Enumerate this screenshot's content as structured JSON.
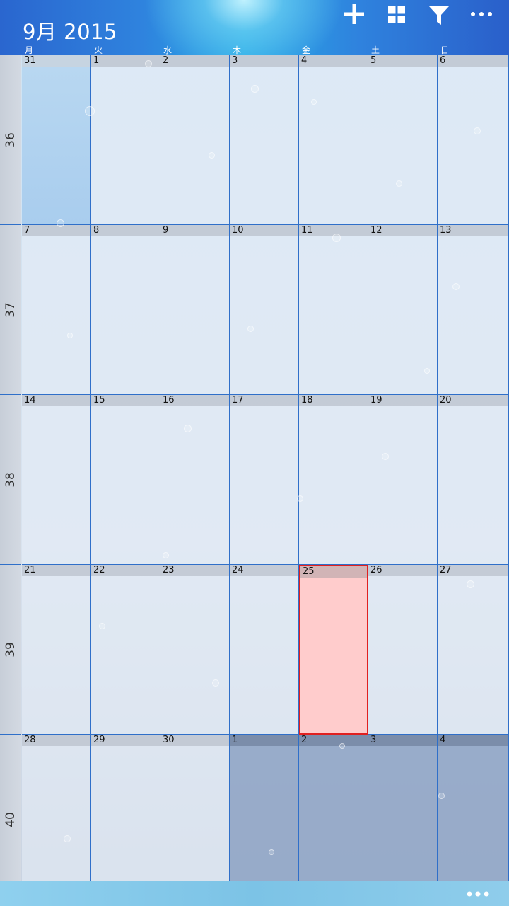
{
  "header": {
    "title": "9月 2015",
    "actions": [
      {
        "name": "add-button",
        "icon": "plus-icon"
      },
      {
        "name": "view-button",
        "icon": "grid-icon"
      },
      {
        "name": "filter-button",
        "icon": "filter-icon"
      },
      {
        "name": "more-button",
        "icon": "ellipsis-icon"
      }
    ]
  },
  "weekdays": [
    "月",
    "火",
    "水",
    "木",
    "金",
    "土",
    "日"
  ],
  "weeks": [
    {
      "number": "36",
      "days": [
        "31",
        "1",
        "2",
        "3",
        "4",
        "5",
        "6"
      ]
    },
    {
      "number": "37",
      "days": [
        "7",
        "8",
        "9",
        "10",
        "11",
        "12",
        "13"
      ]
    },
    {
      "number": "38",
      "days": [
        "14",
        "15",
        "16",
        "17",
        "18",
        "19",
        "20"
      ]
    },
    {
      "number": "39",
      "days": [
        "21",
        "22",
        "23",
        "24",
        "25",
        "26",
        "27"
      ]
    },
    {
      "number": "40",
      "days": [
        "28",
        "29",
        "30",
        "1",
        "2",
        "3",
        "4"
      ]
    }
  ],
  "today": {
    "week": 3,
    "day": 4
  },
  "colors": {
    "accent": "#2f6fc9",
    "today_fill": "#ffcccc",
    "today_border": "#e02020",
    "header_blue": "#2f83de"
  },
  "appbar": {
    "more_icon": "ellipsis-icon"
  }
}
